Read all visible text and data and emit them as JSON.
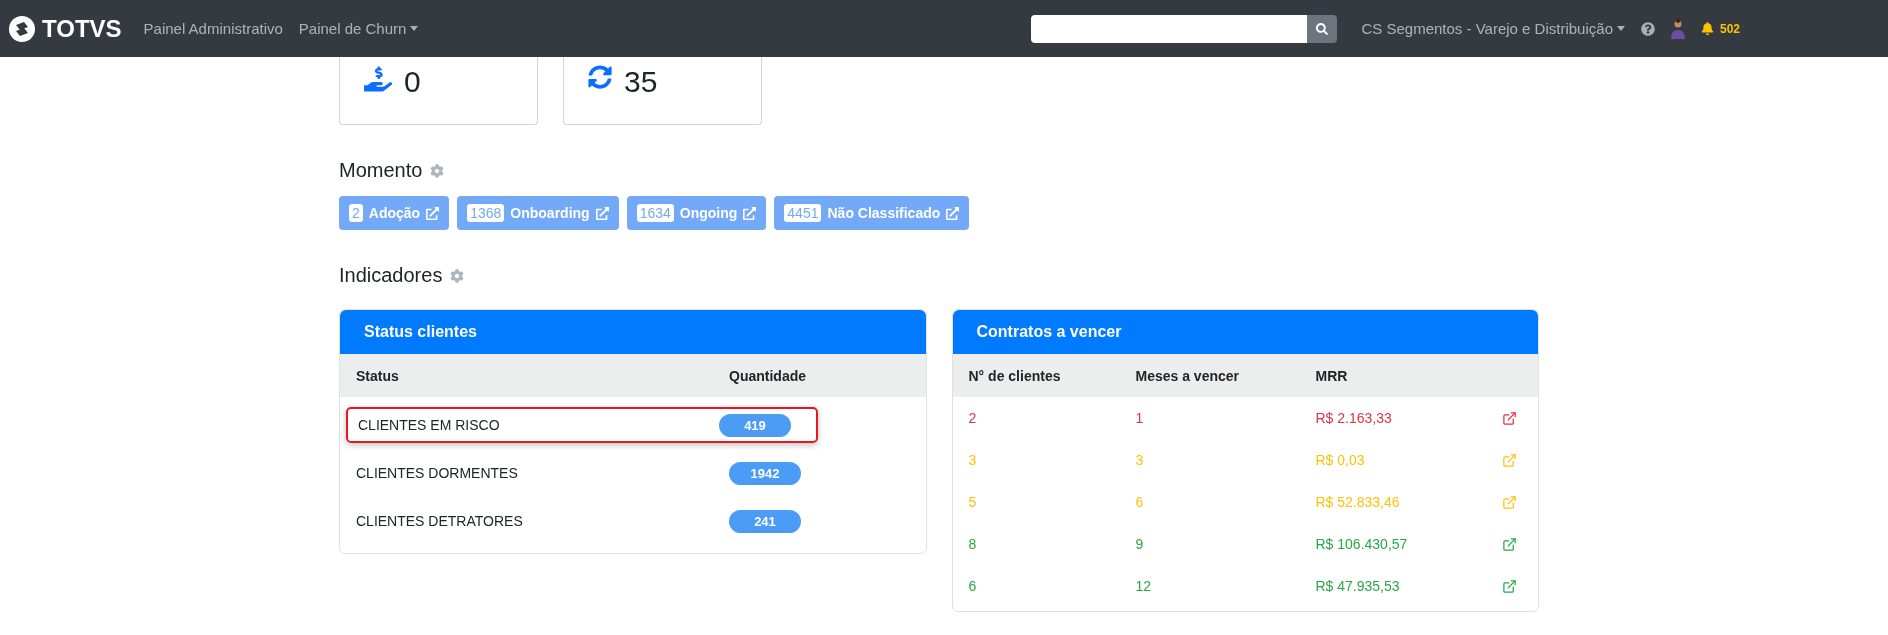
{
  "navbar": {
    "brand": "TOTVS",
    "links": [
      {
        "label": "Painel Administrativo",
        "dropdown": false
      },
      {
        "label": "Painel de Churn",
        "dropdown": true
      }
    ],
    "segment": {
      "label": "CS Segmentos - Varejo e Distribuição",
      "dropdown": true
    },
    "notifications": "502"
  },
  "summary_cards": [
    {
      "kind": "money",
      "value": "0"
    },
    {
      "kind": "sync",
      "value": "35"
    }
  ],
  "momento": {
    "title": "Momento",
    "badges": [
      {
        "count": "2",
        "label": "Adoção"
      },
      {
        "count": "1368",
        "label": "Onboarding"
      },
      {
        "count": "1634",
        "label": "Ongoing"
      },
      {
        "count": "4451",
        "label": "Não Classificado"
      }
    ]
  },
  "indicadores": {
    "title": "Indicadores"
  },
  "status_clientes": {
    "title": "Status clientes",
    "columns": [
      "Status",
      "Quantidade"
    ],
    "rows": [
      {
        "status": "CLIENTES EM RISCO",
        "quantidade": "419",
        "highlighted": true
      },
      {
        "status": "CLIENTES DORMENTES",
        "quantidade": "1942",
        "highlighted": false
      },
      {
        "status": "CLIENTES DETRATORES",
        "quantidade": "241",
        "highlighted": false
      }
    ]
  },
  "contratos": {
    "title": "Contratos a vencer",
    "columns": [
      "N° de clientes",
      "Meses a vencer",
      "MRR"
    ],
    "rows": [
      {
        "clientes": "2",
        "meses": "1",
        "mrr": "R$ 2.163,33",
        "color": "#dc3545"
      },
      {
        "clientes": "3",
        "meses": "3",
        "mrr": "R$ 0,03",
        "color": "#ffc107"
      },
      {
        "clientes": "5",
        "meses": "6",
        "mrr": "R$ 52.833,46",
        "color": "#ffc107"
      },
      {
        "clientes": "8",
        "meses": "9",
        "mrr": "R$ 106.430,57",
        "color": "#28a745"
      },
      {
        "clientes": "6",
        "meses": "12",
        "mrr": "R$ 47.935,53",
        "color": "#28a745"
      }
    ]
  }
}
